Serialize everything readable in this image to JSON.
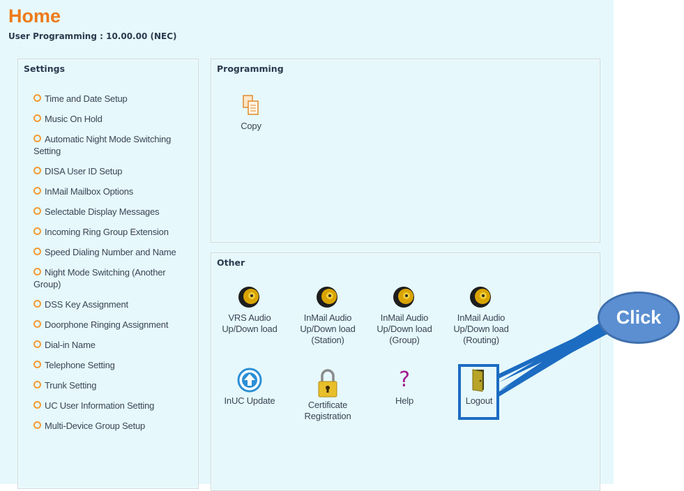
{
  "header": {
    "title": "Home",
    "subtitle": "User Programming : 10.00.00 (NEC)"
  },
  "settings": {
    "title": "Settings",
    "items": [
      "Time and Date Setup",
      "Music On Hold",
      "Automatic Night Mode Switching Setting",
      "DISA User ID Setup",
      "InMail Mailbox Options",
      "Selectable Display Messages",
      "Incoming Ring Group Extension",
      "Speed Dialing Number and Name",
      "Night Mode Switching (Another Group)",
      "DSS Key Assignment",
      "Doorphone Ringing Assignment",
      "Dial-in Name",
      "Telephone Setting",
      "Trunk Setting",
      "UC User Information Setting",
      "Multi-Device Group Setup"
    ]
  },
  "programming": {
    "title": "Programming",
    "copy_label": "Copy"
  },
  "other": {
    "title": "Other",
    "vrs": "VRS Audio Up/Down load",
    "inmail_station": "InMail Audio Up/Down load (Station)",
    "inmail_group": "InMail Audio Up/Down load (Group)",
    "inmail_routing": "InMail Audio Up/Down load (Routing)",
    "inuc": "InUC Update",
    "cert": "Certificate Registration",
    "help": "Help",
    "logout": "Logout"
  },
  "callout": {
    "text": "Click",
    "fill_color": "#5b8fd1",
    "highlight_color": "#1c6cc2"
  }
}
